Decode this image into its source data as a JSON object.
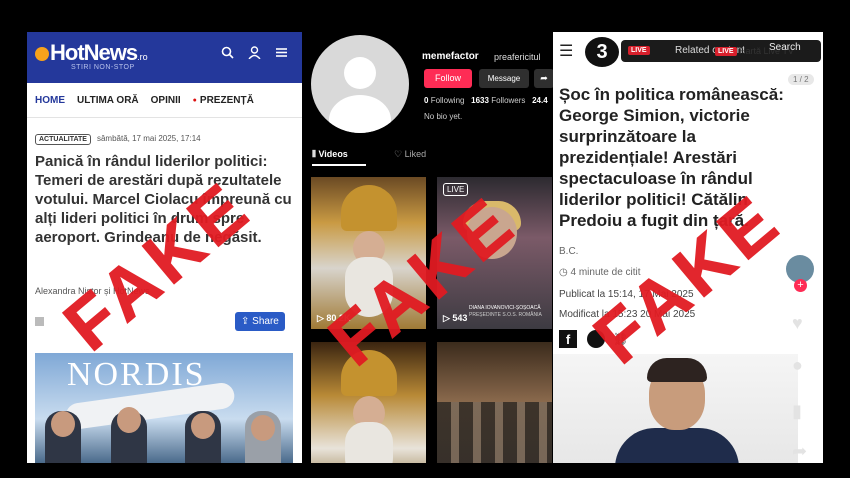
{
  "hotnews": {
    "logo": "HotNews",
    "logo_suffix": ".ro",
    "tagline": "STIRI NON-STOP",
    "nav": [
      "HOME",
      "ULTIMA ORĂ",
      "OPINII",
      "PREZENȚĂ"
    ],
    "badge": "ACTUALITATE",
    "date": "sâmbătă, 17 mai 2025, 17:14",
    "headline": "Panică în rândul liderilor politici: Temeri de arestări după rezultatele votului. Marcel Ciolacu împreună cu alți lideri politici în drum spre aeroport. Grindeanu de negăsit.",
    "author": "Alexandra Nistor și HotNews",
    "share_label": "Share",
    "image_brand": "NORDIS"
  },
  "tiktok": {
    "username": "memefactor",
    "display_name": "preafericitul",
    "follow_label": "Follow",
    "message_label": "Message",
    "following_count": "0",
    "following_label": "Following",
    "followers_count": "1633",
    "followers_label": "Followers",
    "likes_count": "24.4",
    "bio": "No bio yet.",
    "tabs": [
      "Videos",
      "Liked"
    ],
    "videos": [
      {
        "views": "80.2K"
      },
      {
        "views": "543",
        "badge": "LIVE",
        "caption": "DIANA IOVANOVICI-ȘOȘOACĂ",
        "caption2": "PREȘEDINTE S.O.S. ROMÂNIA"
      },
      {
        "views": ""
      },
      {
        "views": ""
      }
    ]
  },
  "article": {
    "related_label": "Related content",
    "live_label": "LIVE",
    "map_label": "Hartă",
    "live_tv_label": "Live TV",
    "search_label": "Search",
    "page_indicator": "1 / 2",
    "headline": "Șoc în politica românească: George Simion, victorie surprinzătoare la prezidențiale! Arestări spectaculoase în rândul liderilor politici! Cătălin Predoiu a fugit din țară.",
    "author": "B.C.",
    "read_time": "4 minute de citit",
    "published": "Publicat la 15:14, 17 Mai 2025",
    "modified": "Modificat la 15:23 20 Mai 2025"
  },
  "stamps": {
    "text": "FAKE",
    "color": "#e11b22"
  },
  "colors": {
    "hotnews_blue": "#24389b",
    "tiktok_red": "#fe2c55"
  }
}
